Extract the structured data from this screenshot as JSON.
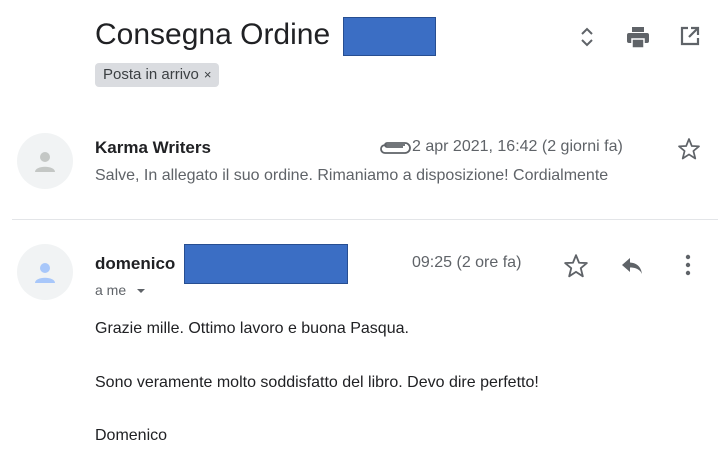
{
  "thread": {
    "subject": "Consegna Ordine",
    "label": "Posta in arrivo",
    "label_remove": "×"
  },
  "toolbar": {
    "expand_icon": "unfold-icon",
    "print_icon": "print-icon",
    "popout_icon": "open-in-new-window-icon"
  },
  "messages": [
    {
      "sender": "Karma Writers",
      "date": "2 apr 2021, 16:42 (2 giorni fa)",
      "snippet": "Salve, In allegato il suo ordine. Rimaniamo a disposizione! Cordialmente",
      "has_attachment": true,
      "starred": false
    },
    {
      "sender": "domenico",
      "recipient": "a me",
      "date": "09:25 (2 ore fa)",
      "starred": false,
      "body": [
        "Grazie mille. Ottimo lavoro e buona Pasqua.",
        "Sono veramente molto soddisfatto del libro. Devo dire perfetto!",
        "Domenico"
      ]
    }
  ],
  "colors": {
    "redaction": "#3b6ec4",
    "chip_bg": "#dadce0",
    "avatar_bg": "#f1f3f4",
    "avatar_fg": "#c4c7c5",
    "avatar_fg_active": "#a8c7fa",
    "secondary_text": "#5f6368"
  }
}
